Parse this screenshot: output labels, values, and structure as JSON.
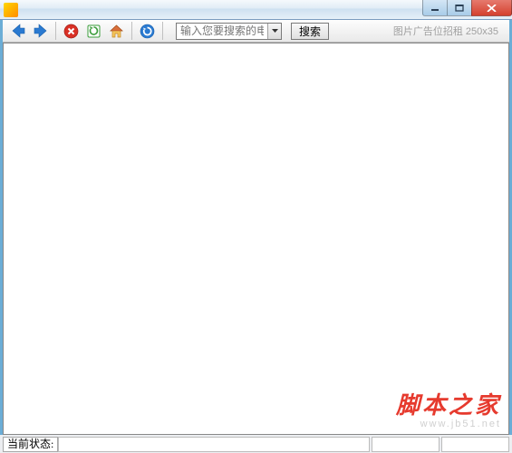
{
  "search": {
    "placeholder": "输入您要搜索的电影名..",
    "button_label": "搜索"
  },
  "ad": {
    "text": "图片广告位招租 250x35"
  },
  "status": {
    "label": "当前状态:"
  },
  "watermark": {
    "line1": "脚本之家",
    "line2": "www.jb51.net"
  },
  "icons": {
    "back": "back-arrow",
    "forward": "forward-arrow",
    "stop": "stop",
    "refresh": "refresh",
    "home": "home",
    "reload": "reload-circle"
  }
}
